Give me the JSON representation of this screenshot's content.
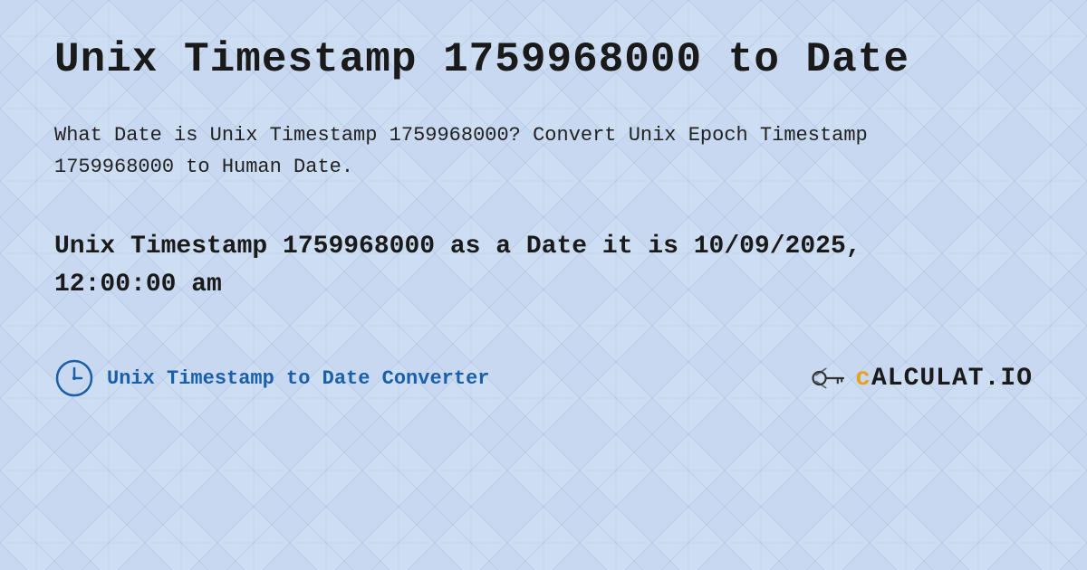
{
  "background": {
    "color": "#c8d8f0",
    "pattern": "diamond-grid"
  },
  "header": {
    "title": "Unix Timestamp 1759968000 to Date"
  },
  "description": {
    "text": "What Date is Unix Timestamp 1759968000? Convert Unix Epoch Timestamp 1759968000 to Human Date."
  },
  "result": {
    "text": "Unix Timestamp 1759968000 as a Date it is 10/09/2025, 12:00:00 am"
  },
  "footer": {
    "converter_label": "Unix Timestamp to Date Converter",
    "brand_name": "CALCULAT.IO"
  },
  "icons": {
    "clock": "clock-icon",
    "brand": "calculat-brand-icon"
  }
}
